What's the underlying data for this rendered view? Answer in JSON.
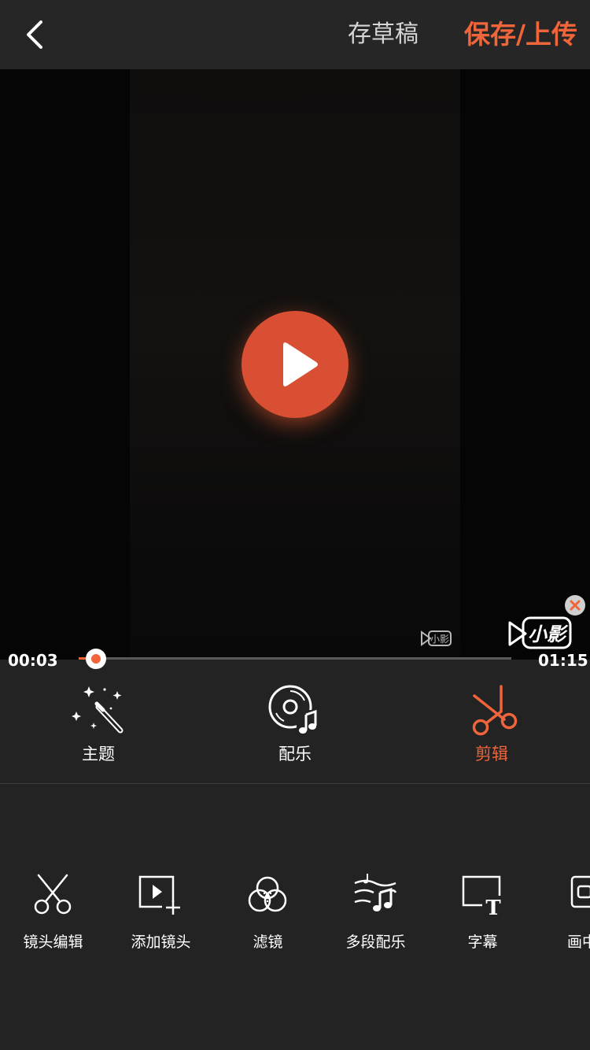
{
  "header": {
    "save_draft_label": "存草稿",
    "save_upload_label": "保存/上传"
  },
  "player": {
    "current_time": "00:03",
    "total_time": "01:15",
    "progress": 0.04,
    "watermark_text": "小影"
  },
  "main_tabs": [
    {
      "label": "主题",
      "icon": "magic-wand-icon",
      "active": false
    },
    {
      "label": "配乐",
      "icon": "music-disc-icon",
      "active": false
    },
    {
      "label": "剪辑",
      "icon": "scissors-icon",
      "active": true
    }
  ],
  "tools": [
    {
      "label": "镜头编辑",
      "icon": "scissors-icon"
    },
    {
      "label": "添加镜头",
      "icon": "add-clip-icon"
    },
    {
      "label": "滤镜",
      "icon": "filter-icon"
    },
    {
      "label": "多段配乐",
      "icon": "multi-music-icon"
    },
    {
      "label": "字幕",
      "icon": "subtitle-icon"
    },
    {
      "label": "画中画",
      "icon": "pip-icon"
    }
  ],
  "colors": {
    "accent": "#f0653a",
    "background": "#232323"
  }
}
